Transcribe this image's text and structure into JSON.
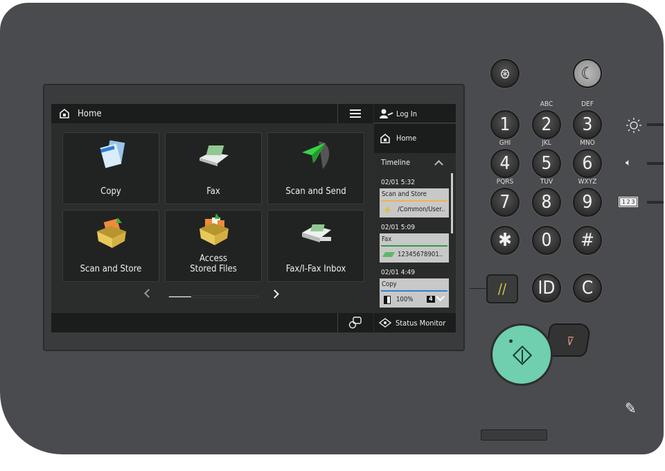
{
  "screen": {
    "header": {
      "title": "Home",
      "home_icon": "home-icon",
      "menu_icon": "hamburger-menu-icon"
    },
    "tiles": [
      {
        "label": "Copy",
        "icon": "copy-icon"
      },
      {
        "label": "Fax",
        "icon": "fax-icon"
      },
      {
        "label": "Scan and Send",
        "icon": "paper-plane-icon"
      },
      {
        "label": "Scan and Store",
        "icon": "box-store-icon"
      },
      {
        "label_line1": "Access",
        "label_line2": "Stored Files",
        "icon": "stored-files-icon"
      },
      {
        "label": "Fax/I-Fax Inbox",
        "icon": "fax-inbox-icon"
      }
    ],
    "pager": {
      "page": 1,
      "pages": 4
    },
    "sidebar": {
      "login": "Log In",
      "home": "Home",
      "timeline": "Timeline",
      "entries": [
        {
          "time": "02/01 5:32",
          "job": "Scan and Store",
          "detail": "/Common/User..",
          "color": "#e8b84a"
        },
        {
          "time": "02/01 5:09",
          "job": "Fax",
          "detail": "12345678901..",
          "color": "#2e9e3e"
        },
        {
          "time": "02/01 4:49",
          "job": "Copy",
          "detail": "100%",
          "copies": "4",
          "color": "#2f7fd8"
        }
      ],
      "status_monitor": "Status Monitor"
    }
  },
  "keypad": {
    "keys": [
      {
        "digit": "1",
        "letters": ""
      },
      {
        "digit": "2",
        "letters": "ABC"
      },
      {
        "digit": "3",
        "letters": "DEF"
      },
      {
        "digit": "4",
        "letters": "GHI"
      },
      {
        "digit": "5",
        "letters": "JKL"
      },
      {
        "digit": "6",
        "letters": "MNO"
      },
      {
        "digit": "7",
        "letters": "PQRS"
      },
      {
        "digit": "8",
        "letters": "TUV"
      },
      {
        "digit": "9",
        "letters": "WXYZ"
      },
      {
        "digit": "✱",
        "letters": ""
      },
      {
        "digit": "0",
        "letters": ""
      },
      {
        "digit": "#",
        "letters": ""
      }
    ],
    "id_label": "ID",
    "clear_label": "C",
    "counter_label": "1 2 3",
    "start_color": "#6fcfae"
  }
}
